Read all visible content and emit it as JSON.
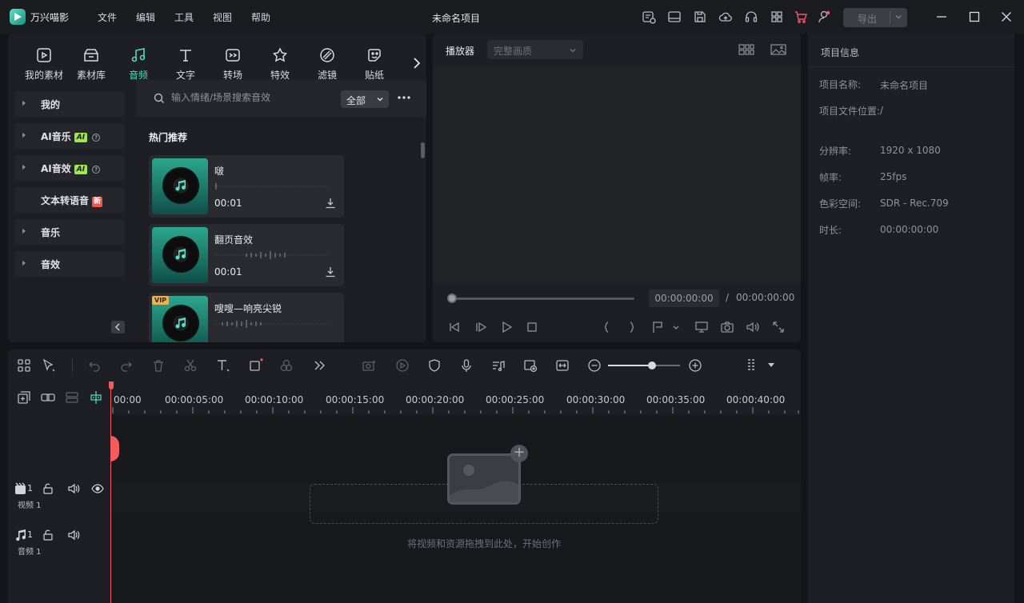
{
  "app": {
    "name": "万兴喵影",
    "title": "未命名项目",
    "menu": [
      "文件",
      "编辑",
      "工具",
      "视图",
      "帮助"
    ],
    "export_label": "导出"
  },
  "media": {
    "tabs": [
      {
        "label": "我的素材",
        "icon": "media-icon",
        "active": false
      },
      {
        "label": "素材库",
        "icon": "stock-icon",
        "active": false
      },
      {
        "label": "音频",
        "icon": "music-note-icon",
        "active": true
      },
      {
        "label": "文字",
        "icon": "text-icon",
        "active": false
      },
      {
        "label": "转场",
        "icon": "transition-icon",
        "active": false
      },
      {
        "label": "特效",
        "icon": "effects-icon",
        "active": false
      },
      {
        "label": "滤镜",
        "icon": "filter-icon",
        "active": false
      },
      {
        "label": "贴纸",
        "icon": "sticker-icon",
        "active": false
      }
    ],
    "categories": [
      {
        "label": "我的",
        "badge": "",
        "help": false,
        "arrow": true
      },
      {
        "label": "AI音乐",
        "badge": "AI",
        "help": true,
        "arrow": true
      },
      {
        "label": "AI音效",
        "badge": "AI",
        "help": true,
        "arrow": true
      },
      {
        "label": "文本转语音",
        "badge": "新",
        "help": false,
        "arrow": false
      },
      {
        "label": "音乐",
        "badge": "",
        "help": false,
        "arrow": true
      },
      {
        "label": "音效",
        "badge": "",
        "help": false,
        "arrow": true
      }
    ],
    "search_placeholder": "输入情绪/场景搜索音效",
    "filter_label": "全部",
    "section_title": "热门推荐",
    "sounds": [
      {
        "name": "啵",
        "duration": "00:01",
        "vip": false
      },
      {
        "name": "翻页音效",
        "duration": "00:01",
        "vip": false
      },
      {
        "name": "嗖嗖—响亮尖锐",
        "duration": "",
        "vip": true
      }
    ],
    "vip_label": "VIP"
  },
  "player": {
    "label": "播放器",
    "quality": "完整画质",
    "current_time": "00:00:00:00",
    "separator": "/",
    "total_time": "00:00:00:00"
  },
  "info": {
    "title": "项目信息",
    "rows": [
      {
        "key": "项目名称:",
        "value": "未命名项目"
      },
      {
        "key": "项目文件位置:",
        "value": "/"
      },
      {
        "key": "分辨率:",
        "value": "1920 x 1080"
      },
      {
        "key": "帧率:",
        "value": "25fps"
      },
      {
        "key": "色彩空间:",
        "value": "SDR - Rec.709"
      },
      {
        "key": "时长:",
        "value": "00:00:00:00"
      }
    ]
  },
  "timeline": {
    "ticks": [
      "00:00",
      "00:00:05:00",
      "00:00:10:00",
      "00:00:15:00",
      "00:00:20:00",
      "00:00:25:00",
      "00:00:30:00",
      "00:00:35:00",
      "00:00:40:00"
    ],
    "zoom_level": 0.6,
    "tracks": [
      {
        "label": "视频 1",
        "index": "1",
        "type": "video"
      },
      {
        "label": "音频 1",
        "index": "1",
        "type": "audio"
      }
    ],
    "drop_hint": "将视频和资源拖拽到此处，开始创作"
  },
  "colors": {
    "accent": "#4fd8bd",
    "playhead": "#f25c5c",
    "ai_badge": "#9ee84a",
    "new_badge": "#f0564e",
    "vip_badge": "#e8b25a"
  }
}
